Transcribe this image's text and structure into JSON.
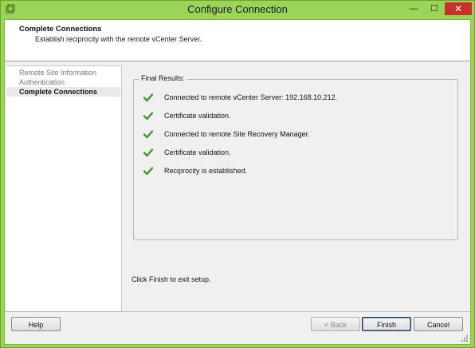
{
  "window": {
    "title": "Configure Connection"
  },
  "titlebar_controls": {
    "minimize": "—",
    "maximize": "☐",
    "close": "✕"
  },
  "header": {
    "title": "Complete Connections",
    "subtitle": "Establish reciprocity with the remote vCenter Server."
  },
  "sidebar": {
    "steps": [
      {
        "label": "Remote Site Information",
        "state": "done"
      },
      {
        "label": "Authentication",
        "state": "done"
      },
      {
        "label": "Complete Connections",
        "state": "current"
      }
    ]
  },
  "results": {
    "group_label": "Final Results:",
    "items": [
      {
        "text": "Connected to remote vCenter Server: 192.168.10.212.",
        "icon": "check-icon"
      },
      {
        "text": "Certificate validation.",
        "icon": "check-icon"
      },
      {
        "text": "Connected  to remote Site Recovery Manager.",
        "icon": "check-icon"
      },
      {
        "text": "Certificate validation.",
        "icon": "check-icon"
      },
      {
        "text": "Reciprocity is established.",
        "icon": "check-icon"
      }
    ]
  },
  "finish_hint": "Click Finish to exit setup.",
  "buttons": {
    "help": "Help",
    "back": "< Back",
    "finish": "Finish",
    "cancel": "Cancel"
  },
  "colors": {
    "titlebar": "#9cd45a",
    "check": "#3c9a2a",
    "close": "#c7302b"
  }
}
